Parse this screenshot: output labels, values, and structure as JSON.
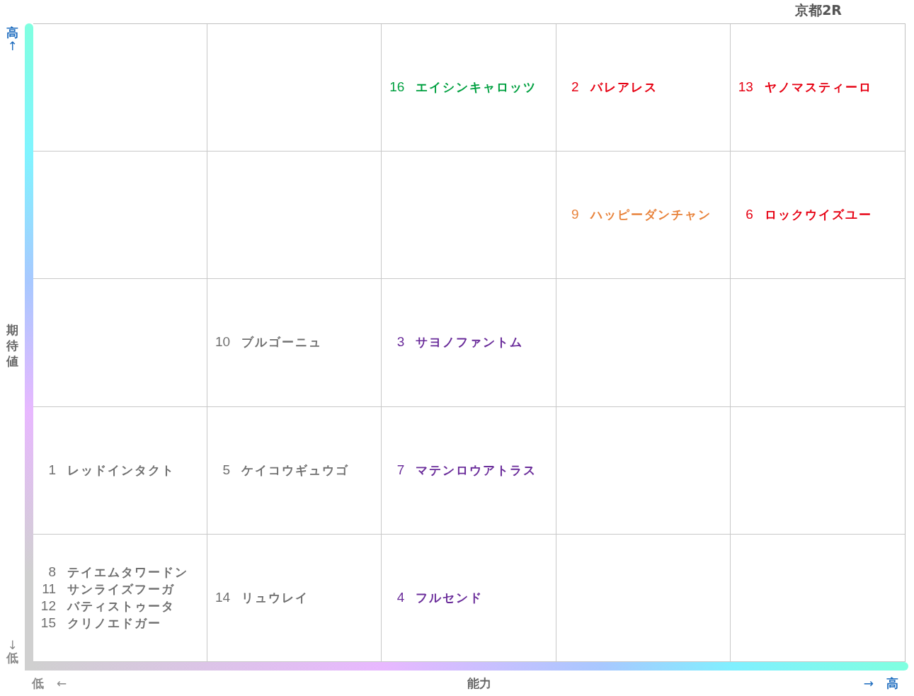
{
  "title": "京都2R",
  "y_axis": {
    "high": "高",
    "up_arrow": "↑",
    "label": "期待値",
    "down_arrow": "↓",
    "low": "低"
  },
  "x_axis": {
    "low": "低",
    "left_arrow": "←",
    "label": "能力",
    "right_arrow": "→",
    "high": "高"
  },
  "rows": [
    {
      "cells": [
        [],
        [],
        [
          {
            "number": "16",
            "name": "エイシンキャロッツ",
            "color": "#00a040"
          }
        ],
        [
          {
            "number": "2",
            "name": "バレアレス",
            "color": "#e60012"
          }
        ],
        [
          {
            "number": "13",
            "name": "ヤノマスティーロ",
            "color": "#e60012"
          }
        ]
      ]
    },
    {
      "cells": [
        [],
        [],
        [],
        [
          {
            "number": "9",
            "name": "ハッピーダンチャン",
            "color": "#e8823a"
          }
        ],
        [
          {
            "number": "6",
            "name": "ロックウイズユー",
            "color": "#e60012"
          }
        ]
      ]
    },
    {
      "cells": [
        [],
        [
          {
            "number": "10",
            "name": "ブルゴーニュ",
            "color": "#707070"
          }
        ],
        [
          {
            "number": "3",
            "name": "サヨノファントム",
            "color": "#6a2c9a"
          }
        ],
        [],
        []
      ]
    },
    {
      "cells": [
        [
          {
            "number": "1",
            "name": "レッドインタクト",
            "color": "#707070"
          }
        ],
        [
          {
            "number": "5",
            "name": "ケイコウギュウゴ",
            "color": "#707070"
          }
        ],
        [
          {
            "number": "7",
            "name": "マテンロウアトラス",
            "color": "#6a2c9a"
          }
        ],
        [],
        []
      ]
    },
    {
      "cells": [
        [
          {
            "number": "8",
            "name": "テイエムタワードン",
            "color": "#707070"
          },
          {
            "number": "11",
            "name": "サンライズフーガ",
            "color": "#707070"
          },
          {
            "number": "12",
            "name": "バティストゥータ",
            "color": "#707070"
          },
          {
            "number": "15",
            "name": "クリノエドガー",
            "color": "#707070"
          }
        ],
        [
          {
            "number": "14",
            "name": "リュウレイ",
            "color": "#707070"
          }
        ],
        [
          {
            "number": "4",
            "name": "フルセンド",
            "color": "#6a2c9a"
          }
        ],
        [],
        []
      ]
    }
  ]
}
